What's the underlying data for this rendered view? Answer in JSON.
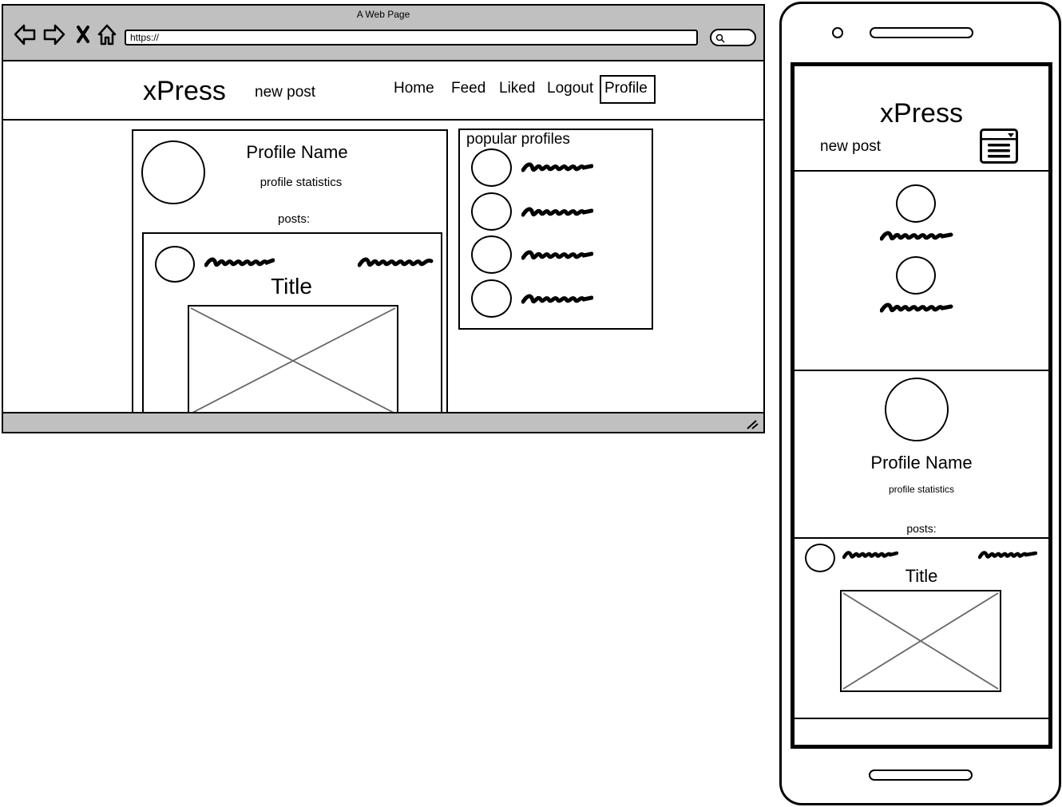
{
  "browser": {
    "title": "A Web Page",
    "url": "https://"
  },
  "desktop": {
    "logo": "xPress",
    "new_post": "new post",
    "nav": {
      "home": "Home",
      "feed": "Feed",
      "liked": "Liked",
      "logout": "Logout",
      "profile": "Profile"
    },
    "profile": {
      "name": "Profile Name",
      "stats": "profile statistics",
      "posts_label": "posts:",
      "post_title": "Title"
    },
    "popular": {
      "title": "popular profiles"
    }
  },
  "mobile": {
    "logo": "xPress",
    "new_post": "new post",
    "profile": {
      "name": "Profile Name",
      "stats": "profile statistics",
      "posts_label": "posts:",
      "post_title": "Title"
    }
  },
  "icons": [
    "back-arrow-icon",
    "forward-arrow-icon",
    "close-icon",
    "home-icon",
    "search-icon",
    "resize-grip-icon",
    "menu-icon"
  ],
  "colors": {
    "chrome": "#c0c0c0",
    "ink": "#000000",
    "placeholder_lines": "#666666"
  }
}
